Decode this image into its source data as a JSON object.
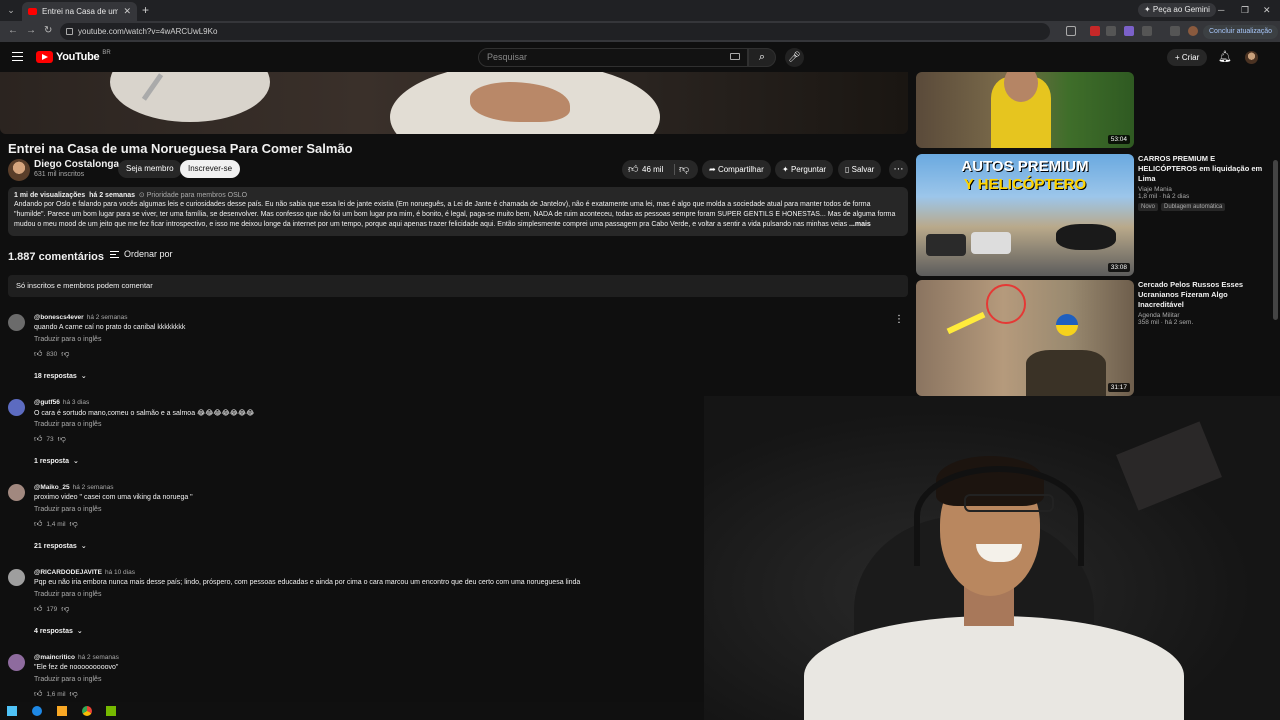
{
  "browser": {
    "tab_title": "Entrei na Casa de uma Norueg...",
    "new_tab": "+",
    "gemini": "✦ Peça ao Gemini",
    "url": "youtube.com/watch?v=4wARCUwL9Ko",
    "update_button": "Concluir atualização"
  },
  "header": {
    "logo_word": "YouTube",
    "logo_region": "BR",
    "search_placeholder": "Pesquisar",
    "create_label": "+ Criar"
  },
  "video": {
    "title": "Entrei na Casa de uma Norueguesa Para Comer Salmão",
    "channel_name": "Diego Costalonga",
    "subscribers": "631 mil inscritos",
    "member_button": "Seja membro",
    "subscribe_button": "Inscrever-se",
    "likes": "46 mil",
    "share_label": "Compartilhar",
    "ask_label": "Perguntar",
    "save_label": "Salvar"
  },
  "description": {
    "views": "1 mi de visualizações",
    "date": "há 2 semanas",
    "tags": "⊙ Prioridade para membros  OSLO",
    "text": "Andando por Oslo e falando para vocês algumas leis e curiosidades desse país. Eu não sabia que essa lei de jante existia (Em norueguês, a Lei de Jante é chamada de Jantelov), não é exatamente uma lei, mas é algo que molda a sociedade atual para manter todos de forma \"humilde\". Parece um bom lugar para se viver, ter uma família, se desenvolver. Mas confesso que não foi um bom lugar pra mim, é bonito, é legal, paga-se muito bem, NADA de ruim aconteceu, todas as pessoas sempre foram SUPER GENTILS E HONESTAS... Mas de alguma forma mudou o meu mood de um jeito que me fez ficar introspectivo, e isso me deixou longe da internet por um tempo, porque aqui apenas trazer felicidade aqui. Então simplesmente comprei uma passagem pra Cabo Verde, e voltar a sentir a vida pulsando nas minhas veias",
    "more": "...mais"
  },
  "comments": {
    "count": "1.887 comentários",
    "sort_label": "Ordenar por",
    "notice": "Só inscritos e membros podem comentar",
    "translate": "Traduzir para o inglês",
    "items": [
      {
        "user": "@bonescs4ever",
        "ago": "há 2 semanas",
        "text": "quando A carne caí no prato do canibal kkkkkkkk",
        "likes": "830",
        "replies": "18 respostas"
      },
      {
        "user": "@gutf56",
        "ago": "há 3 dias",
        "text": "O cara é sortudo mano,comeu o salmão e a salmoa 😂😂😂😂😂😂😂",
        "likes": "73",
        "replies": "1 resposta"
      },
      {
        "user": "@Maiko_25",
        "ago": "há 2 semanas",
        "text": "proximo video \" casei com uma viking da noruega \"",
        "likes": "1,4 mil",
        "replies": "21 respostas"
      },
      {
        "user": "@RICARDODEJAVITE",
        "ago": "há 10 dias",
        "text": "Pqp eu não iria embora nunca mais desse país; lindo, próspero, com pessoas educadas e ainda por cima o cara marcou um encontro que deu certo com uma norueguesa linda",
        "likes": "179",
        "replies": "4 respostas"
      },
      {
        "user": "@maincritico",
        "ago": "há 2 semanas",
        "text": "\"Ele fez de nooooooooovo\"",
        "likes": "1,6 mil",
        "replies": ""
      }
    ]
  },
  "sidebar": [
    {
      "title": "",
      "channel": "",
      "stats": "",
      "duration": "53:04"
    },
    {
      "title": "CARROS PREMIUM E HELICÓPTEROS em liquidação em Lima",
      "channel": "Viaje Mania",
      "stats": "1,8 mil · há 2 dias",
      "duration": "33:08",
      "thumb_text_1": "AUTOS PREMIUM",
      "thumb_text_2": "Y HELICÓPTERO",
      "tag_new": "Novo",
      "tag_dub": "Dublagem automática"
    },
    {
      "title": "Cercado Pelos Russos Esses Ucranianos Fizeram Algo Inacreditável",
      "channel": "Agenda Militar",
      "stats": "358 mil · há 2 sem.",
      "duration": "31:17"
    }
  ],
  "colors": {
    "background": "#0f0f0f",
    "surface": "#272727",
    "brand_red": "#ff0000",
    "text": "#f1f1f1",
    "muted": "#aaaaaa"
  }
}
